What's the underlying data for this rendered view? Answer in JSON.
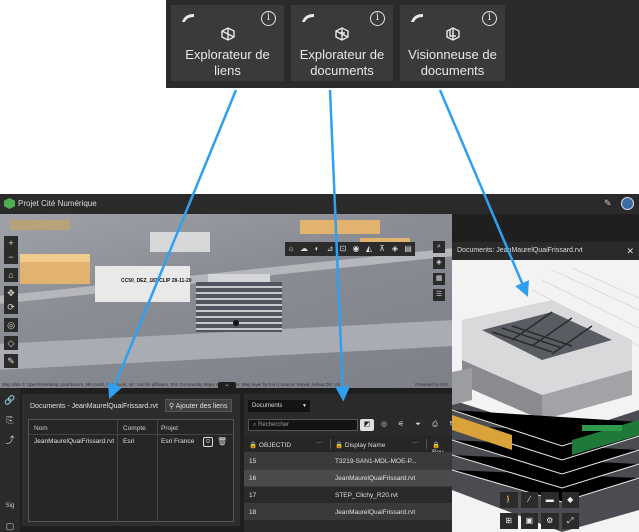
{
  "cards": [
    {
      "title_line1": "Explorateur de",
      "title_line2": "liens",
      "info": "i"
    },
    {
      "title_line1": "Explorateur de",
      "title_line2": "documents",
      "info": "i"
    },
    {
      "title_line1": "Visionneuse de",
      "title_line2": "documents",
      "info": "i"
    }
  ],
  "app": {
    "title": "Projet Cité Numérique"
  },
  "map": {
    "label": "CC50_DEZ_183 CLIP 28-11-20",
    "attribution": "Map data © OpenStreetMap contributors, Microsoft, Facebook, Inc. and its affiliates, Esri Community Maps contributors, Map layer by Esri | Source: Moxar, Airbus DS, US...",
    "powered": "Powered by Esri",
    "toggle": "⌄"
  },
  "left_strip": {
    "label": "Sig"
  },
  "link_panel": {
    "title": "Documents - JeanMaurelQuaiFrissard.rvt",
    "add_button": "Ajouter des liens",
    "columns": [
      "Nom",
      "Compte",
      "Projet"
    ],
    "rows": [
      {
        "nom": "JeanMaurelQuaiFrissard.rvt",
        "compte": "Esri",
        "projet": "Esri France"
      }
    ]
  },
  "doc_panel": {
    "selector": "Documents",
    "search_placeholder": "Rechercher",
    "columns": [
      "OBJECTID",
      "Display Name",
      "Bou"
    ],
    "rows": [
      {
        "id": "15",
        "name": "T3219-SAN1-MDL-MOE-P..."
      },
      {
        "id": "16",
        "name": "JeanMaurelQuaiFrissard.rvt"
      },
      {
        "id": "17",
        "name": "STEP_Clichy_R20.rvt"
      },
      {
        "id": "18",
        "name": "JeanMaurelQuaiFrissard.rvt"
      }
    ]
  },
  "viewer": {
    "title": "Documents: JeanMaurelQuaiFrissard.rvt"
  },
  "colors": {
    "accent_arrow": "#2f9ff0",
    "brand_logo": "#4caf50"
  }
}
